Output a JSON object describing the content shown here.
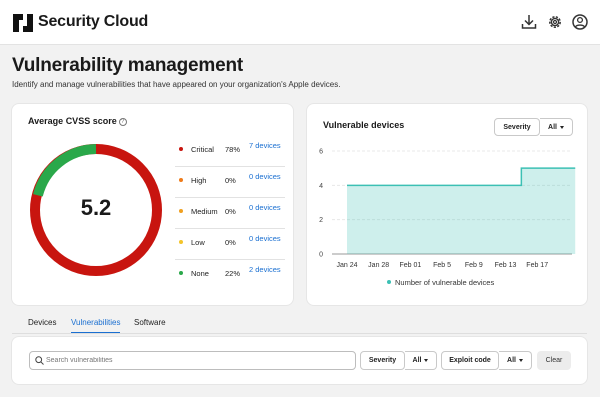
{
  "header": {
    "brand": "Security Cloud",
    "icons": [
      "download-icon",
      "gear-icon",
      "user-icon"
    ]
  },
  "page": {
    "title": "Vulnerability management",
    "subtitle": "Identify and manage vulnerabilities that have appeared on your organization's Apple devices."
  },
  "cvss": {
    "title": "Average CVSS score",
    "score": "5.2",
    "rows": [
      {
        "label": "Critical",
        "pct": "78%",
        "link": "7 devices",
        "color": "#c8150f"
      },
      {
        "label": "High",
        "pct": "0%",
        "link": "0 devices",
        "color": "#ef7b1a"
      },
      {
        "label": "Medium",
        "pct": "0%",
        "link": "0 devices",
        "color": "#f0a020"
      },
      {
        "label": "Low",
        "pct": "0%",
        "link": "0 devices",
        "color": "#f3c42a"
      },
      {
        "label": "None",
        "pct": "22%",
        "link": "2 devices",
        "color": "#2aa84a"
      }
    ]
  },
  "vuln": {
    "title": "Vulnerable devices",
    "severity_label": "Severity",
    "severity_value": "All"
  },
  "chart_data": {
    "type": "area",
    "title": "Vulnerable devices",
    "x": [
      "Jan 24",
      "Jan 28",
      "Feb 01",
      "Feb 5",
      "Feb 9",
      "Feb 13",
      "Feb 17"
    ],
    "series": [
      {
        "name": "Number of vulnerable devices",
        "points": [
          [
            0,
            4
          ],
          [
            5.5,
            4
          ],
          [
            5.5,
            5
          ],
          [
            7.2,
            5
          ]
        ],
        "color": "#3cc0b4"
      }
    ],
    "yticks": [
      0,
      2,
      4,
      6
    ],
    "ylim": [
      0,
      6
    ],
    "grid": true,
    "legend": "bottom"
  },
  "tabs": [
    {
      "label": "Devices",
      "active": false
    },
    {
      "label": "Vulnerabilities",
      "active": true
    },
    {
      "label": "Software",
      "active": false
    }
  ],
  "filters": {
    "search_placeholder": "Search vulnerabilities",
    "severity_label": "Severity",
    "severity_value": "All",
    "exploit_label": "Exploit code",
    "exploit_value": "All",
    "clear_label": "Clear"
  }
}
